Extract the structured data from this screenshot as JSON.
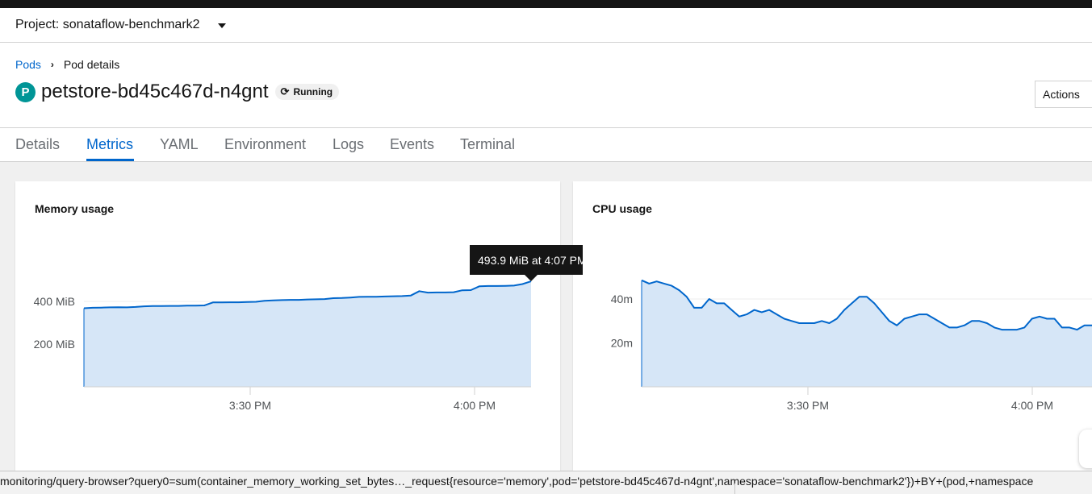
{
  "project": {
    "label": "Project: sonataflow-benchmark2"
  },
  "breadcrumb": {
    "root": "Pods",
    "current": "Pod details"
  },
  "pod": {
    "badge": "P",
    "name": "petstore-bd45c467d-n4gnt",
    "status": "Running"
  },
  "actions": {
    "label": "Actions"
  },
  "tabs": [
    {
      "label": "Details",
      "active": false
    },
    {
      "label": "Metrics",
      "active": true
    },
    {
      "label": "YAML",
      "active": false
    },
    {
      "label": "Environment",
      "active": false
    },
    {
      "label": "Logs",
      "active": false
    },
    {
      "label": "Events",
      "active": false
    },
    {
      "label": "Terminal",
      "active": false
    }
  ],
  "colors": {
    "accent": "#0066cc",
    "line": "#0066cc",
    "area": "#d6e6f7",
    "badge": "#009596"
  },
  "memory_card": {
    "title": "Memory usage",
    "tooltip": "493.9 MiB at 4:07 PM"
  },
  "cpu_card": {
    "title": "CPU usage"
  },
  "chart_data": [
    {
      "type": "area",
      "title": "Memory usage",
      "unit": "MiB",
      "x_ticks": [
        "3:30 PM",
        "4:00 PM"
      ],
      "y_ticks": [
        "200 MiB",
        "400 MiB"
      ],
      "ylim": [
        0,
        600
      ],
      "xlim": [
        "3:10 PM",
        "4:07 PM"
      ],
      "series": [
        {
          "values": [
            368,
            370,
            371,
            372,
            373,
            372,
            374,
            377,
            378,
            378,
            379,
            379,
            380,
            380,
            381,
            395,
            395,
            396,
            396,
            397,
            398,
            403,
            405,
            406,
            407,
            407,
            409,
            410,
            411,
            415,
            416,
            418,
            421,
            422,
            422,
            423,
            424,
            425,
            427,
            448,
            441,
            442,
            442,
            443,
            452,
            453,
            471,
            472,
            472,
            473,
            474,
            481,
            494
          ]
        }
      ]
    },
    {
      "type": "area",
      "title": "CPU usage",
      "x_ticks": [
        "3:30 PM",
        "4:00 PM"
      ],
      "y_ticks": [
        "20m",
        "40m"
      ],
      "ylim": [
        0,
        60
      ],
      "xlim": [
        "3:10 PM",
        "4:07 PM"
      ],
      "series": [
        {
          "values": [
            48.5,
            47,
            48,
            47,
            46,
            44,
            41,
            36,
            36,
            40,
            38,
            38,
            35,
            32,
            33,
            35,
            34,
            35,
            33,
            31,
            30,
            29,
            29,
            29,
            30,
            29,
            31,
            35,
            38,
            41,
            41,
            38,
            34,
            30,
            28,
            31,
            32,
            33,
            33,
            31,
            29,
            27,
            27,
            28,
            30,
            30,
            29,
            27,
            26,
            26,
            26,
            27,
            31,
            32,
            31,
            31,
            27,
            27,
            26,
            28,
            28
          ]
        }
      ]
    }
  ],
  "statusbar": {
    "url": "monitoring/query-browser?query0=sum(container_memory_working_set_bytes…_request{resource='memory',pod='petstore-bd45c467d-n4gnt',namespace='sonataflow-benchmark2'})+BY+(pod,+namespace"
  }
}
